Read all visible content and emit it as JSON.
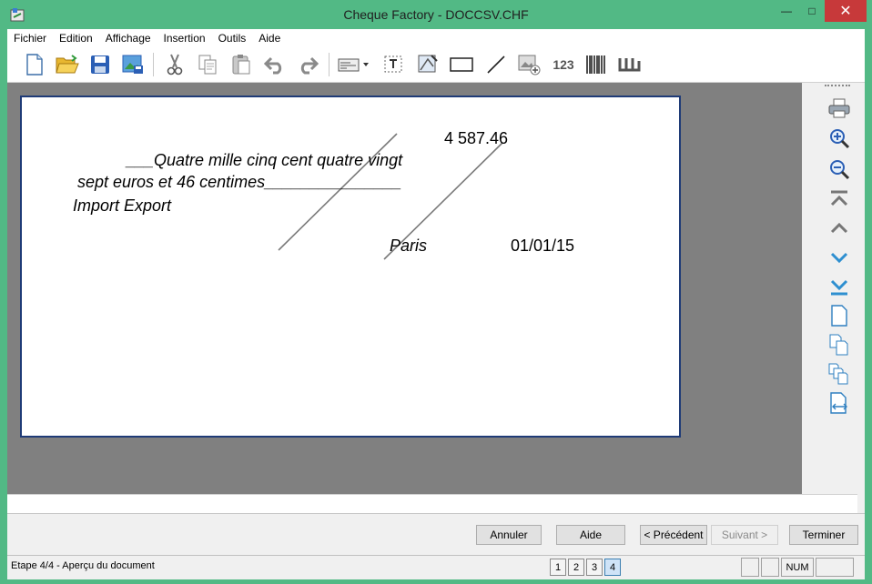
{
  "window": {
    "title": "Cheque Factory - DOCCSV.CHF",
    "close_glyph": "✕",
    "minimize_glyph": "—",
    "maximize_glyph": "□"
  },
  "menu": [
    {
      "id": "fichier",
      "label": "Fichier"
    },
    {
      "id": "edition",
      "label": "Edition"
    },
    {
      "id": "affichage",
      "label": "Affichage"
    },
    {
      "id": "insertion",
      "label": "Insertion"
    },
    {
      "id": "outils",
      "label": "Outils"
    },
    {
      "id": "aide",
      "label": "Aide"
    }
  ],
  "toolbar": {
    "number_label": "123",
    "icons": [
      "new-document-icon",
      "open-folder-icon",
      "save-icon",
      "save-image-icon",
      "cut-icon",
      "copy-icon",
      "paste-icon",
      "undo-icon",
      "redo-icon",
      "cheque-insert-icon",
      "text-frame-icon",
      "image-tool-icon",
      "rectangle-icon",
      "line-icon",
      "insert-image-icon",
      "number-icon",
      "barcode-icon",
      "font-icon"
    ]
  },
  "cheque": {
    "amount": "4 587.46",
    "words_line1": "___Quatre mille cinq cent quatre vingt",
    "words_line2": "sept euros et 46 centimes_______________",
    "payee": "Import Export",
    "place": "Paris",
    "date": "01/01/15"
  },
  "right_panel_icons": [
    "print-icon",
    "zoom-in-icon",
    "zoom-out-icon",
    "first-page-icon",
    "previous-page-icon",
    "next-page-icon",
    "last-page-icon",
    "single-page-icon",
    "two-pages-icon",
    "multi-pages-icon",
    "page-width-icon"
  ],
  "buttons": {
    "annuler": "Annuler",
    "aide": "Aide",
    "precedent": "< Précédent",
    "suivant": "Suivant >",
    "terminer": "Terminer"
  },
  "status": {
    "text": "Etape 4/4 - Aperçu du document",
    "pages": [
      "1",
      "2",
      "3",
      "4"
    ],
    "active_page": "4",
    "num": "NUM"
  },
  "colors": {
    "titlebar": "#52b985",
    "close": "#c7393a",
    "cheque_border": "#1f3b77",
    "workarea": "#808080"
  }
}
